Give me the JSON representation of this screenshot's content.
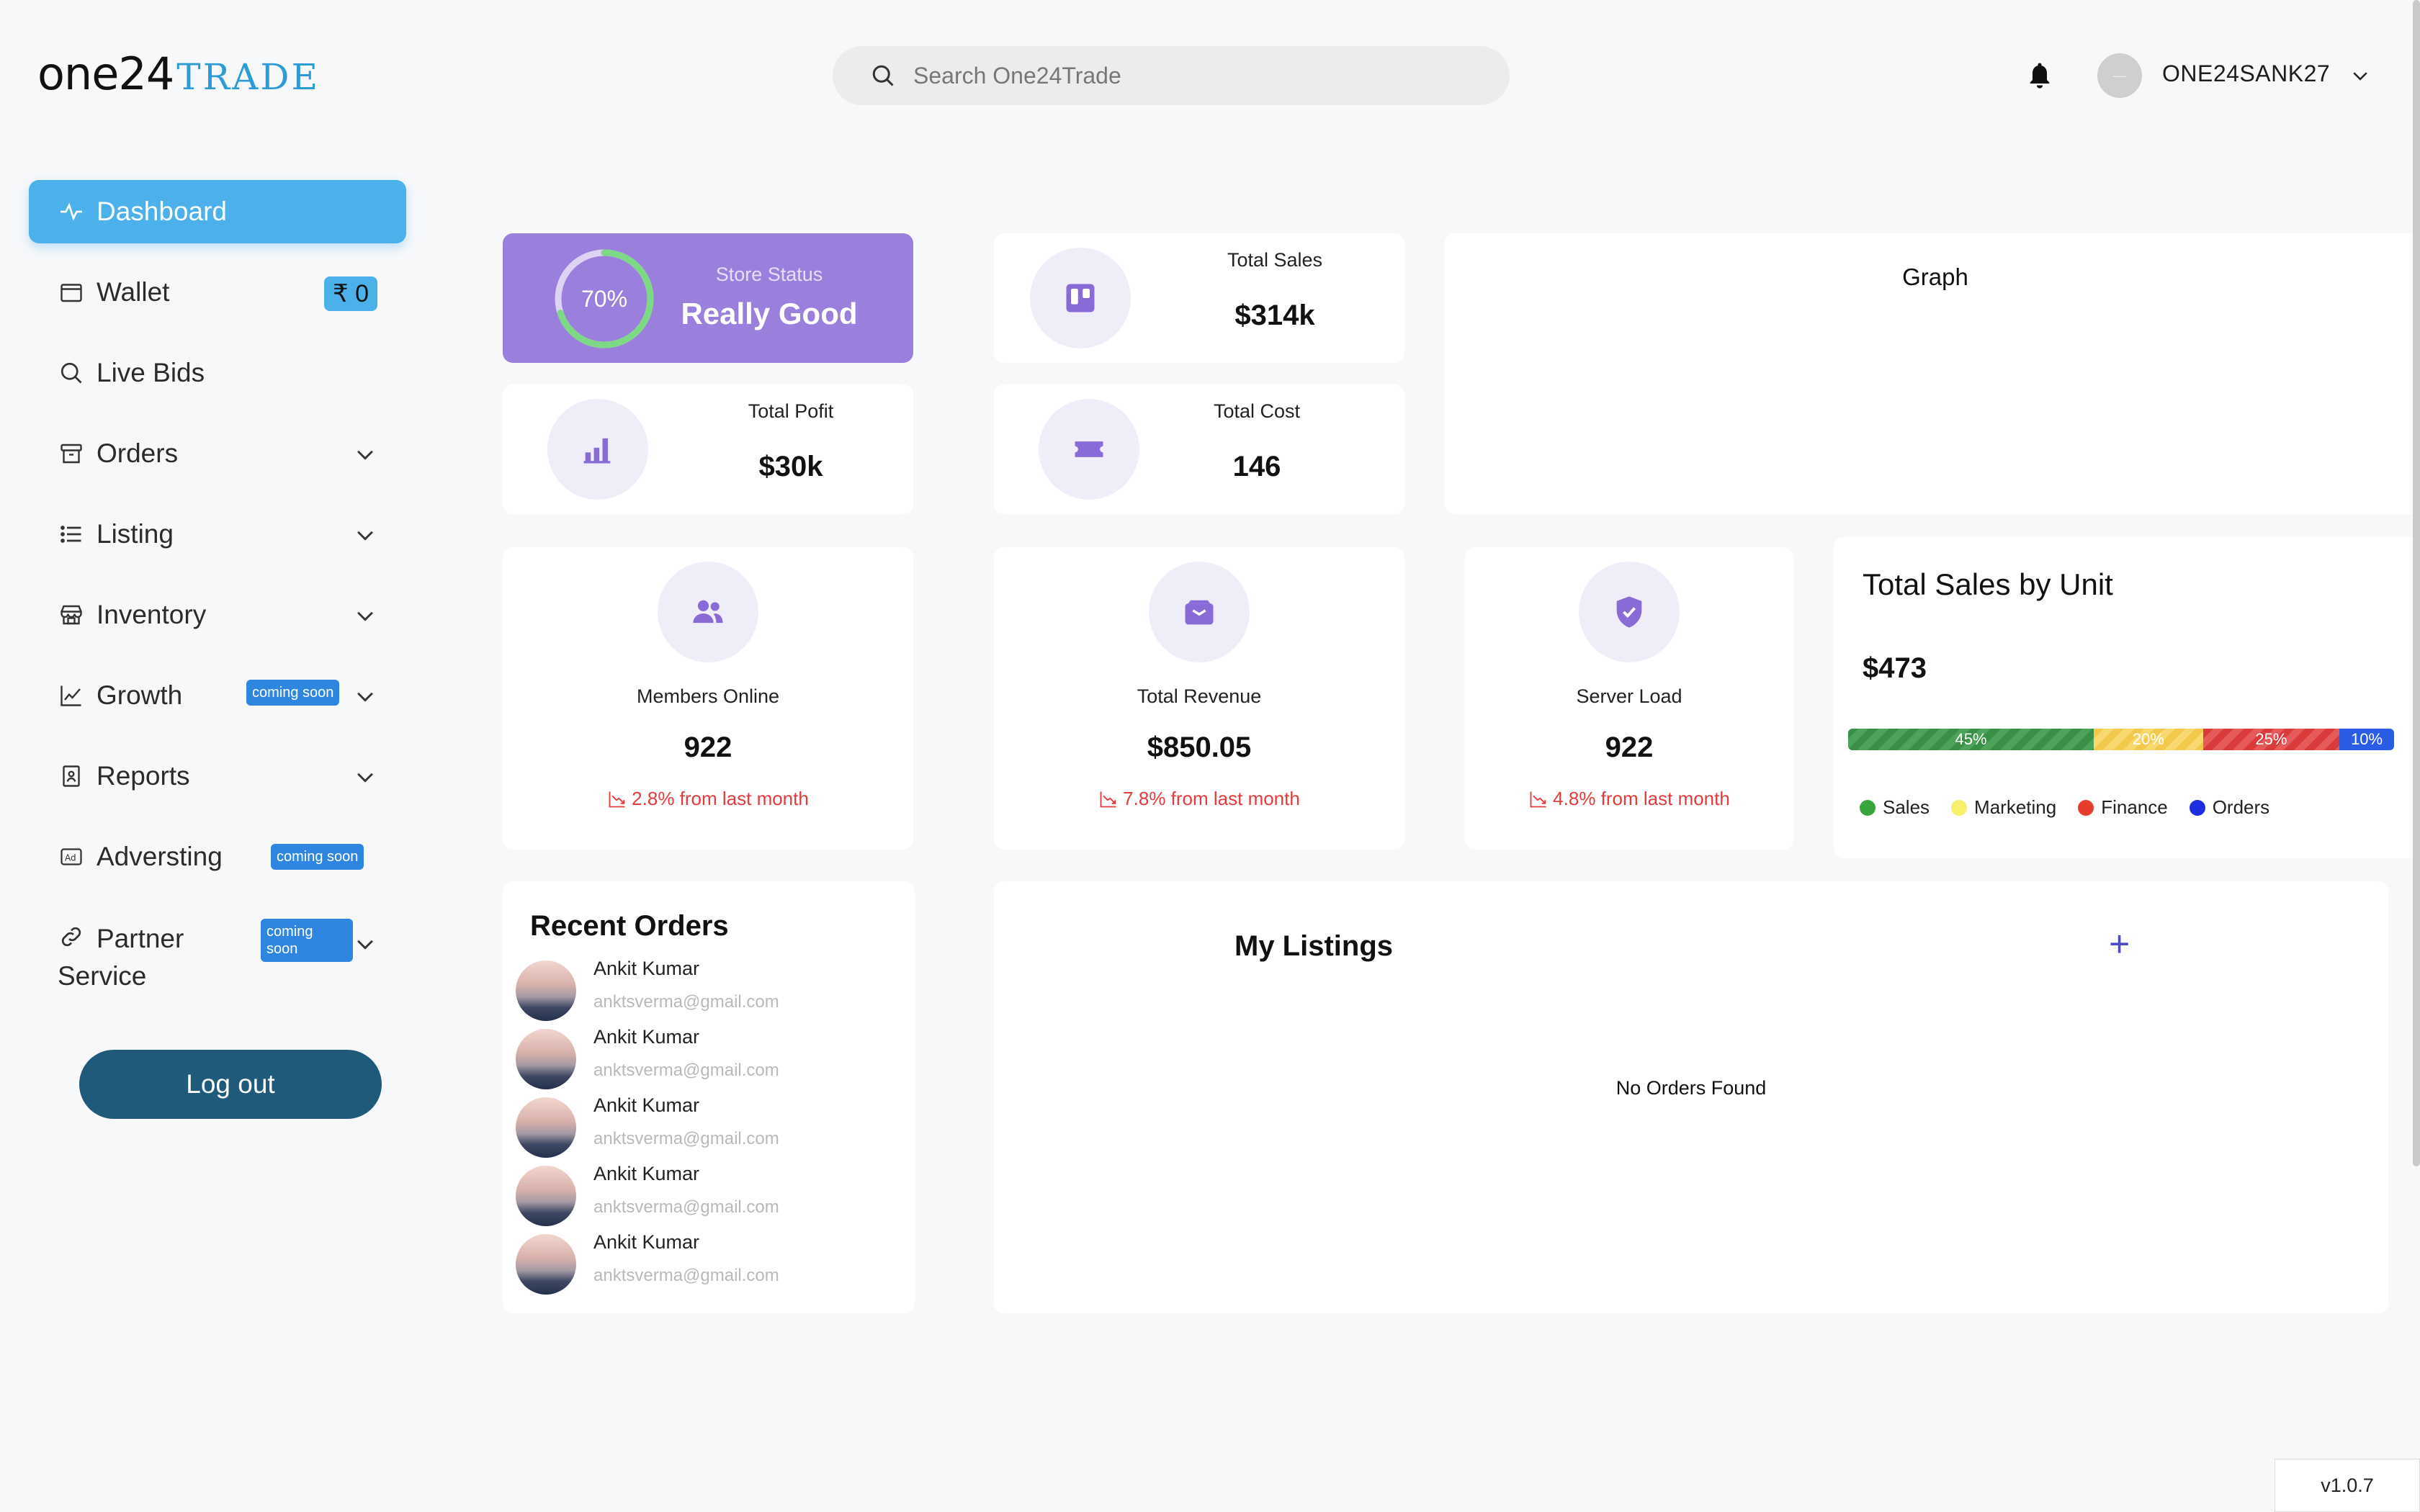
{
  "brand": {
    "name": "one24",
    "suffix": "TRADE"
  },
  "search": {
    "placeholder": "Search One24Trade"
  },
  "user": {
    "name": "ONE24SANK27",
    "avatar_text": "—"
  },
  "sidebar": {
    "items": [
      {
        "label": "Dashboard",
        "icon": "activity-icon",
        "active": true
      },
      {
        "label": "Wallet",
        "icon": "wallet-icon",
        "badge": "₹ 0"
      },
      {
        "label": "Live Bids",
        "icon": "search-icon"
      },
      {
        "label": "Orders",
        "icon": "archive-icon",
        "expandable": true
      },
      {
        "label": "Listing",
        "icon": "list-icon",
        "expandable": true
      },
      {
        "label": "Inventory",
        "icon": "store-icon",
        "expandable": true
      },
      {
        "label": "Growth",
        "icon": "chart-line-icon",
        "badge": "coming soon",
        "expandable": true
      },
      {
        "label": "Reports",
        "icon": "report-icon",
        "expandable": true
      },
      {
        "label": "Adversting",
        "icon": "ad-icon",
        "badge": "coming soon"
      },
      {
        "label_line1": "Partner",
        "label_line2": "Service",
        "icon": "link-icon",
        "badge_line1": "coming",
        "badge_line2": "soon",
        "expandable": true
      }
    ],
    "logout_label": "Log out"
  },
  "store_status": {
    "percent_label": "70%",
    "percent": 0.7,
    "caption": "Store Status",
    "value": "Really Good"
  },
  "total_sales": {
    "label": "Total Sales",
    "value": "$314k"
  },
  "total_profit": {
    "label": "Total Pofit",
    "value": "$30k"
  },
  "total_cost": {
    "label": "Total Cost",
    "value": "146"
  },
  "graph": {
    "title": "Graph"
  },
  "members_online": {
    "label": "Members Online",
    "value": "922",
    "trend": "2.8% from last month"
  },
  "total_revenue": {
    "label": "Total Revenue",
    "value": "$850.05",
    "trend": "7.8% from last month"
  },
  "server_load": {
    "label": "Server Load",
    "value": "922",
    "trend": "4.8% from last month"
  },
  "sales_by_unit": {
    "title": "Total Sales by Unit",
    "value": "$473",
    "segments": [
      {
        "name": "Sales",
        "percent_label": "45%",
        "fraction": 0.45,
        "color": "#3a8f47"
      },
      {
        "name": "Marketing",
        "percent_label": "20%",
        "fraction": 0.2,
        "color": "#f2c94c"
      },
      {
        "name": "Finance",
        "percent_label": "25%",
        "fraction": 0.25,
        "color": "#d93b3b"
      },
      {
        "name": "Orders",
        "percent_label": "10%",
        "fraction": 0.1,
        "color": "#2a5ce6"
      }
    ],
    "legend_colors": {
      "sales": "#3aa53f",
      "marketing": "#f7f06a",
      "finance": "#e53c2e",
      "orders": "#1f2de0"
    }
  },
  "recent_orders": {
    "title": "Recent Orders",
    "rows": [
      {
        "name": "Ankit Kumar",
        "email": "anktsverma@gmail.com"
      },
      {
        "name": "Ankit Kumar",
        "email": "anktsverma@gmail.com"
      },
      {
        "name": "Ankit Kumar",
        "email": "anktsverma@gmail.com"
      },
      {
        "name": "Ankit Kumar",
        "email": "anktsverma@gmail.com"
      },
      {
        "name": "Ankit Kumar",
        "email": "anktsverma@gmail.com"
      }
    ]
  },
  "my_listings": {
    "title": "My Listings",
    "add_label": "+",
    "empty_text": "No Orders Found"
  },
  "version": "v1.0.7",
  "colors": {
    "accent": "#4cb0ea",
    "status_card": "#9b7fdc",
    "logout": "#1f5a7a",
    "trend_down": "#e23b3b"
  }
}
